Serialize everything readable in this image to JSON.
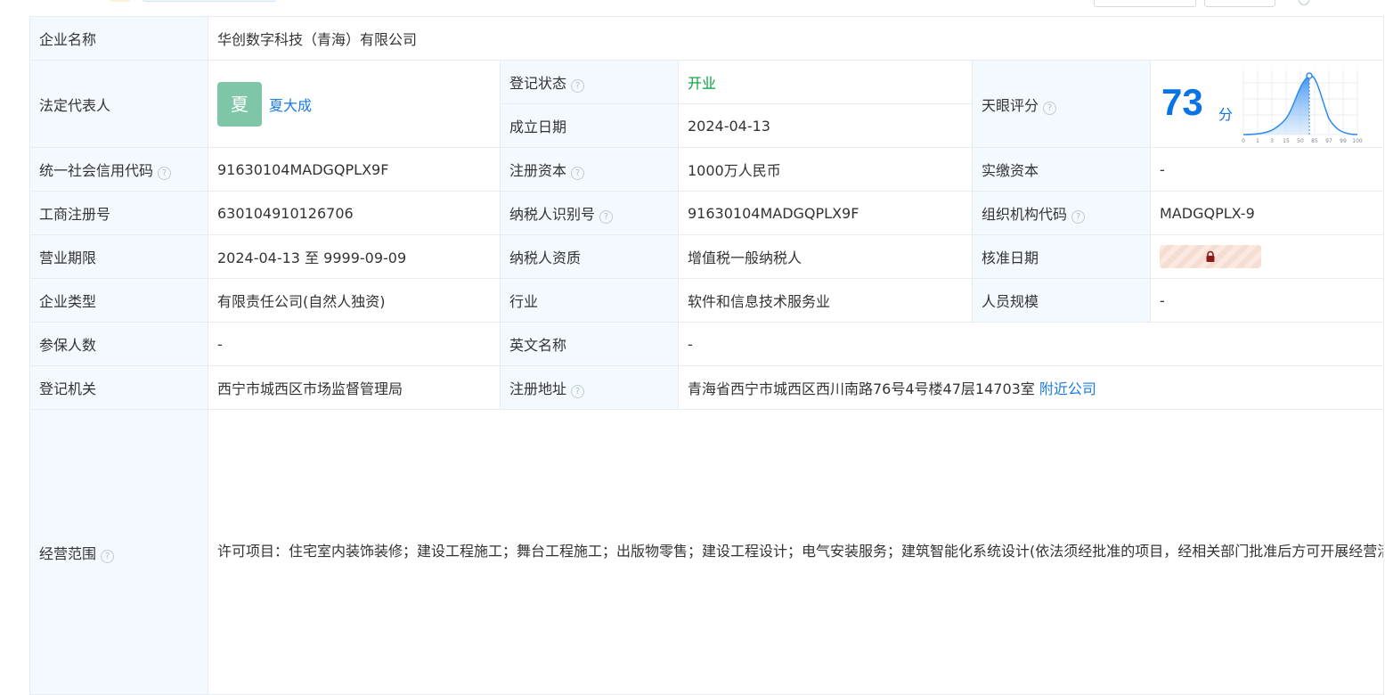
{
  "company": {
    "name_label": "企业名称",
    "name": "华创数字科技（青海）有限公司",
    "legal_rep_label": "法定代表人",
    "legal_rep_avatar": "夏",
    "legal_rep": "夏大成",
    "reg_status_label": "登记状态",
    "reg_status": "开业",
    "found_date_label": "成立日期",
    "found_date": "2024-04-13",
    "tianyan_label": "天眼评分",
    "score": "73",
    "score_unit": "分",
    "score_axis": [
      "0",
      "1",
      "3",
      "15",
      "50",
      "85",
      "97",
      "99",
      "100"
    ],
    "credit_code_label": "统一社会信用代码",
    "credit_code": "91630104MADGQPLX9F",
    "reg_capital_label": "注册资本",
    "reg_capital": "1000万人民币",
    "paid_capital_label": "实缴资本",
    "paid_capital": "-",
    "biz_reg_no_label": "工商注册号",
    "biz_reg_no": "630104910126706",
    "taxpayer_id_label": "纳税人识别号",
    "taxpayer_id": "91630104MADGQPLX9F",
    "org_code_label": "组织机构代码",
    "org_code": "MADGQPLX-9",
    "biz_term_label": "营业期限",
    "biz_term": "2024-04-13 至 9999-09-09",
    "taxpayer_qual_label": "纳税人资质",
    "taxpayer_qual": "增值税一般纳税人",
    "approve_date_label": "核准日期",
    "type_label": "企业类型",
    "type": "有限责任公司(自然人独资)",
    "industry_label": "行业",
    "industry": "软件和信息技术服务业",
    "staff_label": "人员规模",
    "staff": "-",
    "insured_label": "参保人数",
    "insured": "-",
    "english_name_label": "英文名称",
    "english_name": "-",
    "authority_label": "登记机关",
    "authority": "西宁市城西区市场监督管理局",
    "address_label": "注册地址",
    "address": "青海省西宁市城西区西川南路76号4号楼47层14703室",
    "nearby_link": "附近公司",
    "scope_label": "经营范围",
    "scope": "许可项目：住宅室内装饰装修；建设工程施工；舞台工程施工；出版物零售；建设工程设计；电气安装服务；建筑智能化系统设计(依法须经批准的项目，经相关部门批准后方可开展经营活动，具体经营项目以审批结果为准)。一般项目：会议及展览服务；数字内容制作服务（不含出版发行）；组织文化艺术交流活动；业务培训（不含教育培训、职业技能培训等需取得许可的培训）；摄像及视频制作服务；文艺创作；工艺美术品及礼仪用品制造（象牙及其制品除外）；工艺美术品及礼仪用品销售（象牙及其制品除外）；体验式拓展活动及策划；旅游开发项目策划咨询；网络技术服务；网络设备销售；企业形象策划；计算机系统服务；计算机软硬件及辅助设备批发；计算机软硬件及外围设备制造；计算机软硬件及辅助设备零售；网络与信息安全软件开发；信息系统运行维护服务；软件销售；软件开发；数字文化创意软件开发；互联网数据服务；建筑装饰材料销售；建筑材料销售；建筑砌块销售；专业设计服务；城乡市容管理；园林绿化工程施工；文化用品设备出租；数字文化创意内容应用服务；数字文化创意技术装备销售；广告制作；广告设计、代理；平面设计；图文设计制作；科普宣传服务；云计算设备销售；露营地服务；组织体育表演活动；数字创意产品展览展示服务；消防器材销售；办公设备销售；办公设备耗材销售；办公设备租赁服务；办公用品销售；家具销售；家具零配件销售；日用家电零售；家用电器销售；家用电器零配件销售；影视录放设备制造；家用视听设备销售；灯具销售；照明器具销售；日用玻璃制品销售；电气设备销售；电气信号设备装置销售；电子专用设备销售；机械电气设备销售；仪器仪表销售；数字技术服务；技术服务、技术开发、技术咨询、技术交流、技术转让、技术推广；技术玻璃制品制造；技术玻璃制品销售；电工器材销售；防腐材料销售；通讯设备销售；通信设备销售(除依法须经批准的项目外，凭营业执照依法自主开展经营活动)。"
  },
  "icons": {
    "help": "question-circle-icon",
    "lock": "lock-icon"
  },
  "colors": {
    "label_bg": "#f4f9ff",
    "border": "#e6ecf2",
    "status_green": "#00a23a",
    "link_blue": "#1a7ae6",
    "score_blue": "#0a73e6",
    "avatar_bg": "#7fc5a7"
  }
}
